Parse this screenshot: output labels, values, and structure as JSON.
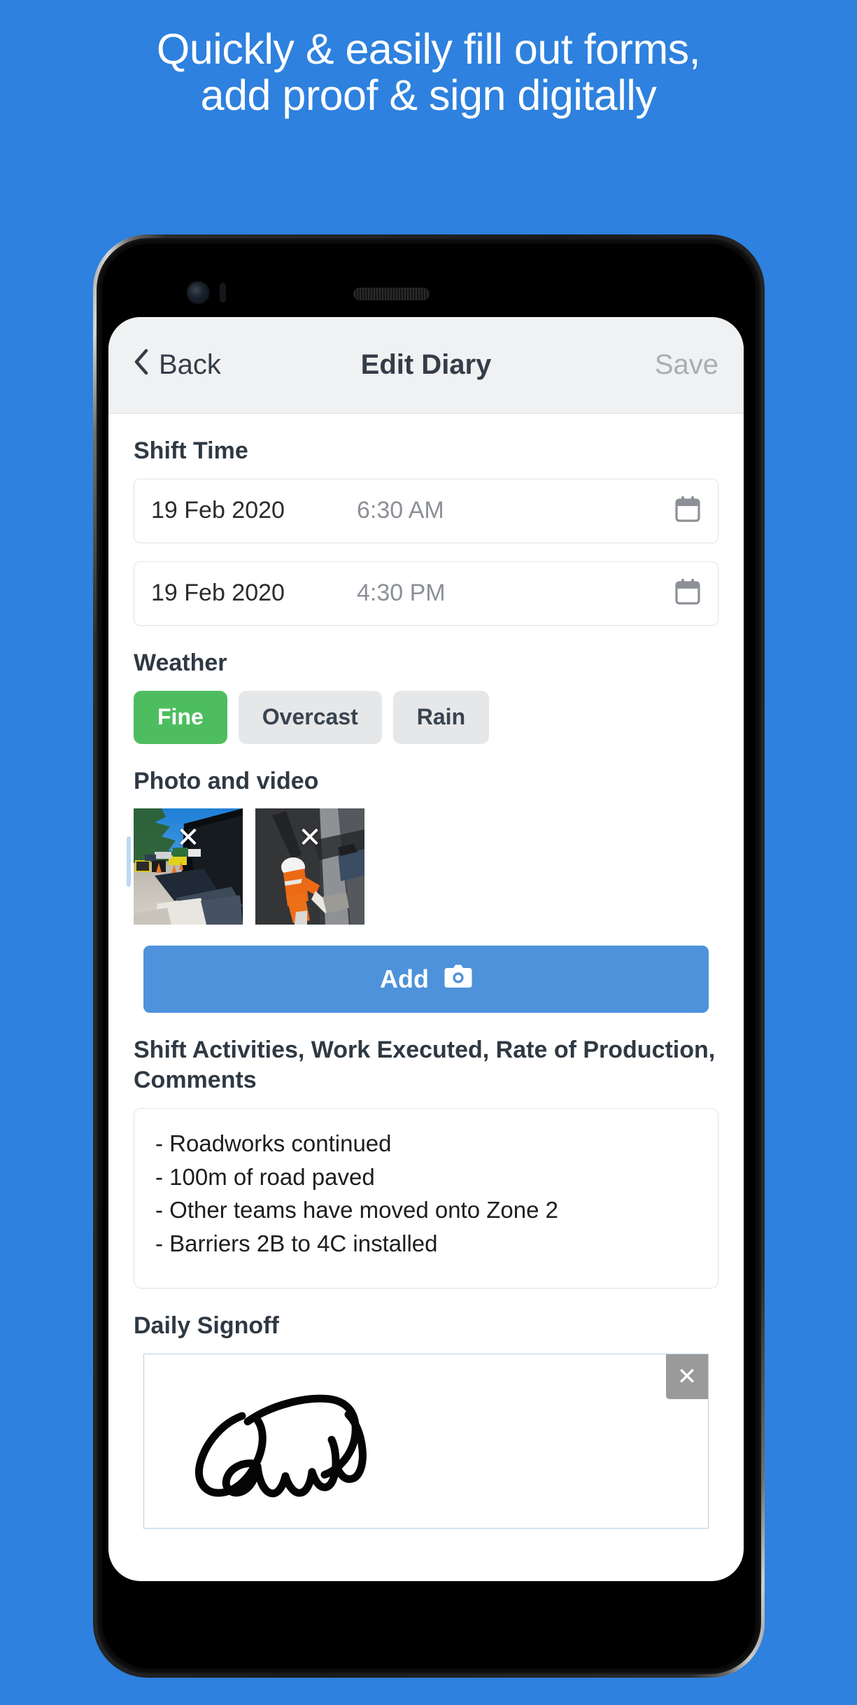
{
  "promo": {
    "headline": "Quickly & easily fill out forms,\nadd proof & sign digitally",
    "background_color": "#2e81de",
    "text_color": "#ffffff"
  },
  "device": {
    "name": "smartphone-mockup",
    "front_camera": "front-camera",
    "earpiece": "earpiece-speaker",
    "buttons": [
      "mute-switch",
      "power-button"
    ]
  },
  "navbar": {
    "back_label": "Back",
    "title": "Edit Diary",
    "save_label": "Save",
    "back_icon": "chevron-left-icon",
    "background_color": "#f0f1f2",
    "title_color": "#343d48",
    "save_color": "#a9adb3"
  },
  "shift_time": {
    "label": "Shift Time",
    "rows": [
      {
        "date": "19 Feb 2020",
        "time": "6:30 AM",
        "icon": "calendar-icon"
      },
      {
        "date": "19 Feb 2020",
        "time": "4:30 PM",
        "icon": "calendar-icon"
      }
    ]
  },
  "weather": {
    "label": "Weather",
    "options": [
      {
        "label": "Fine",
        "selected": true
      },
      {
        "label": "Overcast",
        "selected": false
      },
      {
        "label": "Rain",
        "selected": false
      }
    ],
    "selected_color": "#4ebd60",
    "unselected_color": "#e6e7e8"
  },
  "media": {
    "label": "Photo and video",
    "thumbnails": [
      {
        "alt": "roadworks-site-photo",
        "remove_icon": "close-icon"
      },
      {
        "alt": "worker-paving-photo",
        "remove_icon": "close-icon"
      }
    ],
    "add_button": {
      "label": "Add",
      "icon": "camera-icon",
      "color": "#4d92da"
    }
  },
  "activities": {
    "label": "Shift Activities, Work Executed, Rate of Production, Comments",
    "lines": [
      "- Roadworks continued",
      "- 100m of road paved",
      "- Other teams have moved onto Zone 2",
      "- Barriers 2B to 4C installed"
    ]
  },
  "signoff": {
    "label": "Daily Signoff",
    "clear_icon": "close-icon",
    "signature_alt": "handwritten-signature"
  }
}
